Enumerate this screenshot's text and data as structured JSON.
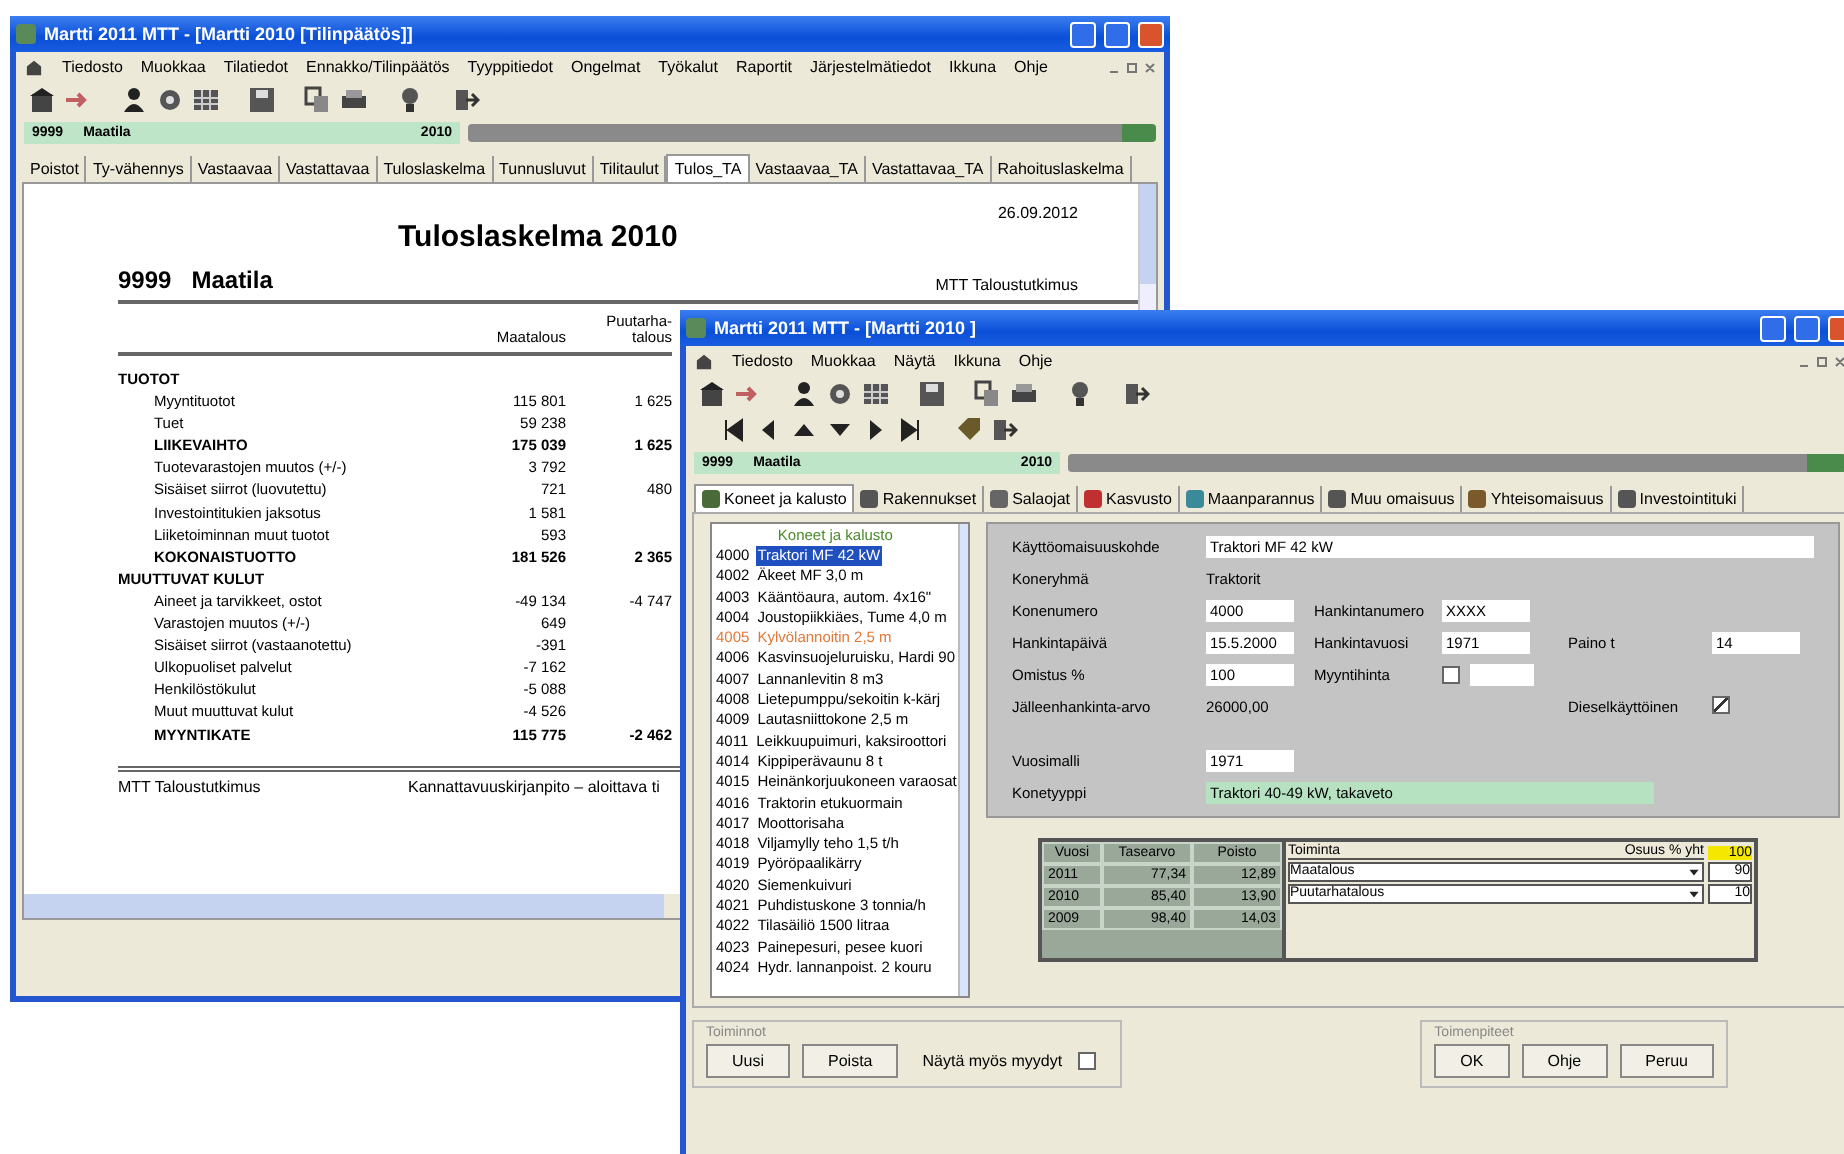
{
  "back_window": {
    "title": "Martti 2011 MTT - [Martti 2010 [Tilinpäätös]]",
    "menu": [
      "Tiedosto",
      "Muokkaa",
      "Tilatiedot",
      "Ennakko/Tilinpäätös",
      "Tyyppitiedot",
      "Ongelmat",
      "Työkalut",
      "Raportit",
      "Järjestelmätiedot",
      "Ikkuna",
      "Ohje"
    ],
    "farm_bar": {
      "code": "9999",
      "name": "Maatila",
      "year": "2010"
    },
    "tabs": [
      {
        "label": "Poistot",
        "selected": false
      },
      {
        "label": "Ty-vähennys",
        "selected": false
      },
      {
        "label": "Vastaavaa",
        "selected": false
      },
      {
        "label": "Vastattavaa",
        "selected": false
      },
      {
        "label": "Tuloslaskelma",
        "selected": false
      },
      {
        "label": "Tunnusluvut",
        "selected": false
      },
      {
        "label": "Tilitaulut",
        "selected": false
      },
      {
        "label": "Tulos_TA",
        "selected": true
      },
      {
        "label": "Vastaavaa_TA",
        "selected": false
      },
      {
        "label": "Vastattavaa_TA",
        "selected": false
      },
      {
        "label": "Rahoituslaskelma",
        "selected": false
      }
    ],
    "report": {
      "title": "Tuloslaskelma  2010",
      "date": "26.09.2012",
      "farm_code": "9999",
      "farm_name": "Maatila",
      "org": "MTT Taloustutkimus",
      "columns": [
        "Maatalous",
        "Puutarha-talous"
      ],
      "rows": [
        {
          "kind": "heading",
          "label": "TUOTOT",
          "values": []
        },
        {
          "kind": "item",
          "label": "Myyntituotot",
          "values": [
            "115 801",
            "1 625"
          ]
        },
        {
          "kind": "item",
          "label": "Tuet",
          "values": [
            "59 238"
          ]
        },
        {
          "kind": "total",
          "label": "LIIKEVAIHTO",
          "values": [
            "175 039",
            "1 625"
          ]
        },
        {
          "kind": "item",
          "label": "Tuotevarastojen muutos (+/-)",
          "values": [
            "3 792"
          ]
        },
        {
          "kind": "item",
          "label": "Sisäiset siirrot (luovutettu)",
          "values": [
            "721",
            "480"
          ]
        },
        {
          "kind": "item",
          "label": "Investointitukien jaksotus",
          "values": [
            "1 581"
          ]
        },
        {
          "kind": "item",
          "label": "Liiketoiminnan muut tuotot",
          "values": [
            "593"
          ]
        },
        {
          "kind": "total",
          "label": "KOKONAISTUOTTO",
          "values": [
            "181 526",
            "2 365"
          ]
        },
        {
          "kind": "heading",
          "label": "MUUTTUVAT KULUT",
          "values": []
        },
        {
          "kind": "item",
          "label": "Aineet ja tarvikkeet, ostot",
          "values": [
            "-49 134",
            "-4 747"
          ]
        },
        {
          "kind": "item",
          "label": "Varastojen muutos (+/-)",
          "values": [
            "649"
          ]
        },
        {
          "kind": "item",
          "label": "Sisäiset siirrot (vastaanotettu)",
          "values": [
            "-391"
          ]
        },
        {
          "kind": "item",
          "label": "Ulkopuoliset palvelut",
          "values": [
            "-7 162"
          ]
        },
        {
          "kind": "item",
          "label": "Henkilöstökulut",
          "values": [
            "-5 088"
          ]
        },
        {
          "kind": "item",
          "label": "Muut muuttuvat kulut",
          "values": [
            "-4 526"
          ]
        },
        {
          "kind": "total",
          "label": "MYYNTIKATE",
          "values": [
            "115 775",
            "-2 462"
          ]
        }
      ],
      "footer_left": "MTT Taloustutkimus",
      "footer_right": "Kannattavuuskirjanpito – aloittava ti"
    }
  },
  "front_window": {
    "title": "Martti 2011 MTT - [Martti 2010 ]",
    "menu": [
      "Tiedosto",
      "Muokkaa",
      "Näytä",
      "Ikkuna",
      "Ohje"
    ],
    "farm_bar": {
      "code": "9999",
      "name": "Maatila",
      "year": "2010"
    },
    "tabs": [
      {
        "label": "Koneet ja kalusto",
        "selected": true
      },
      {
        "label": "Rakennukset",
        "selected": false
      },
      {
        "label": "Salaojat",
        "selected": false
      },
      {
        "label": "Kasvusto",
        "selected": false
      },
      {
        "label": "Maanparannus",
        "selected": false
      },
      {
        "label": "Muu omaisuus",
        "selected": false
      },
      {
        "label": "Yhteisomaisuus",
        "selected": false
      },
      {
        "label": "Investointituki",
        "selected": false
      }
    ],
    "list": {
      "header": "Koneet ja kalusto",
      "items": [
        {
          "code": "4000",
          "name": "Traktori MF 42 kW",
          "selected": true,
          "color": "#000000"
        },
        {
          "code": "4002",
          "name": "Äkeet MF 3,0 m",
          "selected": false,
          "color": "#000000"
        },
        {
          "code": "4003",
          "name": "Kääntöaura, autom. 4x16\"",
          "selected": false,
          "color": "#000000"
        },
        {
          "code": "4004",
          "name": "Joustopiikkiäes, Tume 4,0 m",
          "selected": false,
          "color": "#000000"
        },
        {
          "code": "4005",
          "name": "Kylvölannoitin 2,5 m",
          "selected": false,
          "color": "#e07838"
        },
        {
          "code": "4006",
          "name": "Kasvinsuojeluruisku, Hardi 90",
          "selected": false,
          "color": "#000000"
        },
        {
          "code": "4007",
          "name": "Lannanlevitin 8 m3",
          "selected": false,
          "color": "#000000"
        },
        {
          "code": "4008",
          "name": "Lietepumppu/sekoitin k-kärj",
          "selected": false,
          "color": "#000000"
        },
        {
          "code": "4009",
          "name": "Lautasniittokone 2,5 m",
          "selected": false,
          "color": "#000000"
        },
        {
          "code": "4011",
          "name": "Leikkuupuimuri, kaksiroottori",
          "selected": false,
          "color": "#000000"
        },
        {
          "code": "4014",
          "name": "Kippiperävaunu 8 t",
          "selected": false,
          "color": "#000000"
        },
        {
          "code": "4015",
          "name": "Heinänkorjuukoneen varaosat",
          "selected": false,
          "color": "#000000"
        },
        {
          "code": "4016",
          "name": "Traktorin etukuormain",
          "selected": false,
          "color": "#000000"
        },
        {
          "code": "4017",
          "name": "Moottorisaha",
          "selected": false,
          "color": "#000000"
        },
        {
          "code": "4018",
          "name": "Viljamylly teho 1,5 t/h",
          "selected": false,
          "color": "#000000"
        },
        {
          "code": "4019",
          "name": "Pyöröpaalikärry",
          "selected": false,
          "color": "#000000"
        },
        {
          "code": "4020",
          "name": "Siemenkuivuri",
          "selected": false,
          "color": "#000000"
        },
        {
          "code": "4021",
          "name": "Puhdistuskone 3 tonnia/h",
          "selected": false,
          "color": "#000000"
        },
        {
          "code": "4022",
          "name": "Tilasäiliö 1500 litraa",
          "selected": false,
          "color": "#000000"
        },
        {
          "code": "4023",
          "name": "Painepesuri, pesee kuori",
          "selected": false,
          "color": "#000000"
        },
        {
          "code": "4024",
          "name": "Hydr. lannanpoist. 2 kouru",
          "selected": false,
          "color": "#000000"
        }
      ]
    },
    "form": {
      "name_field": {
        "label": "Käyttöomaisuuskohde",
        "value": "Traktori MF 42 kW"
      },
      "rows": [
        [
          {
            "kind": "text",
            "label": "Koneryhmä",
            "value": "Traktorit"
          }
        ],
        [
          {
            "kind": "input",
            "label": "Konenumero",
            "value": "4000"
          },
          {
            "kind": "input",
            "label": "Hankintanumero",
            "value": "XXXX"
          }
        ],
        [
          {
            "kind": "input",
            "label": "Hankintapäivä",
            "value": "15.5.2000"
          },
          {
            "kind": "input",
            "label": "Hankintavuosi",
            "value": "1971"
          },
          {
            "kind": "input",
            "label": "Paino t",
            "value": "14"
          }
        ],
        [
          {
            "kind": "input",
            "label": "Omistus %",
            "value": "100"
          },
          {
            "kind": "checkbox_input",
            "label": "Myyntihinta",
            "checked": false
          }
        ],
        [
          {
            "kind": "text",
            "label": "Jälleenhankinta-arvo",
            "value": "26000,00"
          },
          {
            "kind": "empty"
          },
          {
            "kind": "checkbox",
            "label": "Dieselkäyttöinen",
            "checked": true
          }
        ],
        [
          {
            "kind": "spacer"
          }
        ],
        [
          {
            "kind": "input",
            "label": "Vuosimalli",
            "value": "1971"
          }
        ]
      ],
      "type_field": {
        "label": "Konetyyppi",
        "value": "Traktori 40-49 kW, takaveto"
      }
    },
    "history": {
      "columns": [
        "Vuosi",
        "Tasearvo",
        "Poisto"
      ],
      "rows": [
        [
          "2011",
          "77,34",
          "12,89"
        ],
        [
          "2010",
          "85,40",
          "13,90"
        ],
        [
          "2009",
          "98,40",
          "14,03"
        ]
      ]
    },
    "shares": {
      "columns": [
        "Toiminta",
        "Osuus % yht"
      ],
      "total": "100",
      "rows": [
        {
          "activity": "Maatalous",
          "share": "90"
        },
        {
          "activity": "Puutarhatalous",
          "share": "10"
        }
      ]
    },
    "actions": {
      "title": "Toiminnot",
      "buttons": [
        "Uusi",
        "Poista"
      ],
      "checkbox": {
        "label": "Näytä myös myydyt",
        "checked": false
      }
    },
    "dialog": {
      "title": "Toimenpiteet",
      "buttons": [
        "OK",
        "Ohje",
        "Peruu"
      ]
    }
  }
}
